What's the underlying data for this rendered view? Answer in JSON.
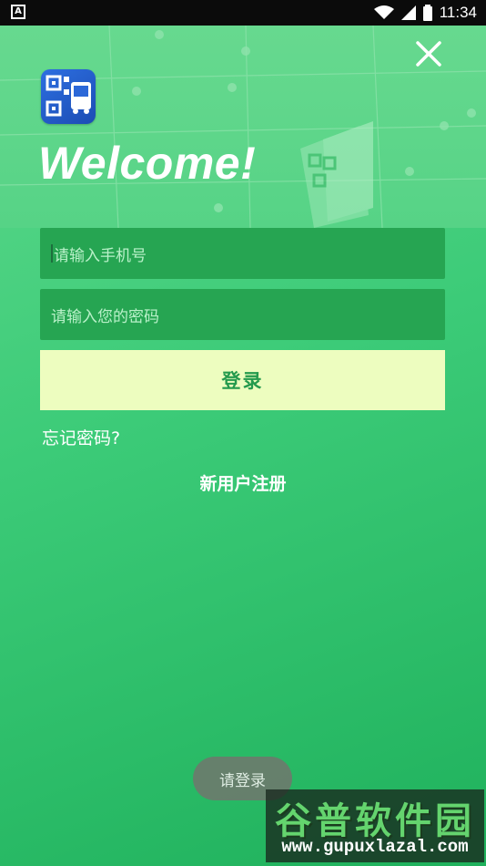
{
  "status_bar": {
    "time": "11:34",
    "notification_icon": "A"
  },
  "header": {
    "welcome": "Welcome!"
  },
  "form": {
    "phone_placeholder": "请输入手机号",
    "password_placeholder": "请输入您的密码",
    "login_label": "登录",
    "forgot_label": "忘记密码?",
    "register_label": "新用户注册"
  },
  "toast": {
    "text": "请登录"
  },
  "watermark": {
    "title": "谷普软件园",
    "url": "www.gupuxlazal.com"
  },
  "colors": {
    "accent": "#26a552",
    "login_bg": "#edfdbf",
    "login_text": "#249a4d"
  }
}
